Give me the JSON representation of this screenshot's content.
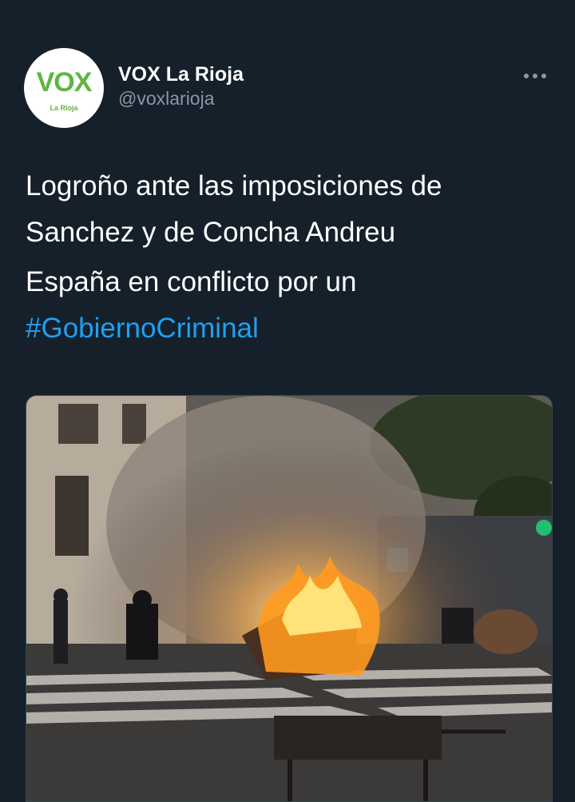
{
  "tweet": {
    "author": {
      "display_name": "VOX La Rioja",
      "handle": "@voxlarioja",
      "avatar_logo": "VOX",
      "avatar_sub": "La Rioja"
    },
    "more_icon": "more-horizontal-icon",
    "text_lines": [
      "Logroño ante las imposiciones de Sanchez y de Concha Andreu",
      "España en conflicto por un"
    ],
    "hashtag": "#GobiernoCriminal",
    "media": {
      "type": "photo",
      "description_icon": "burning-dumpster-photo"
    }
  },
  "colors": {
    "background": "#15202b",
    "text": "#ffffff",
    "secondary_text": "#8899a6",
    "hashtag": "#1da1f2",
    "vox_green": "#5eb541"
  }
}
